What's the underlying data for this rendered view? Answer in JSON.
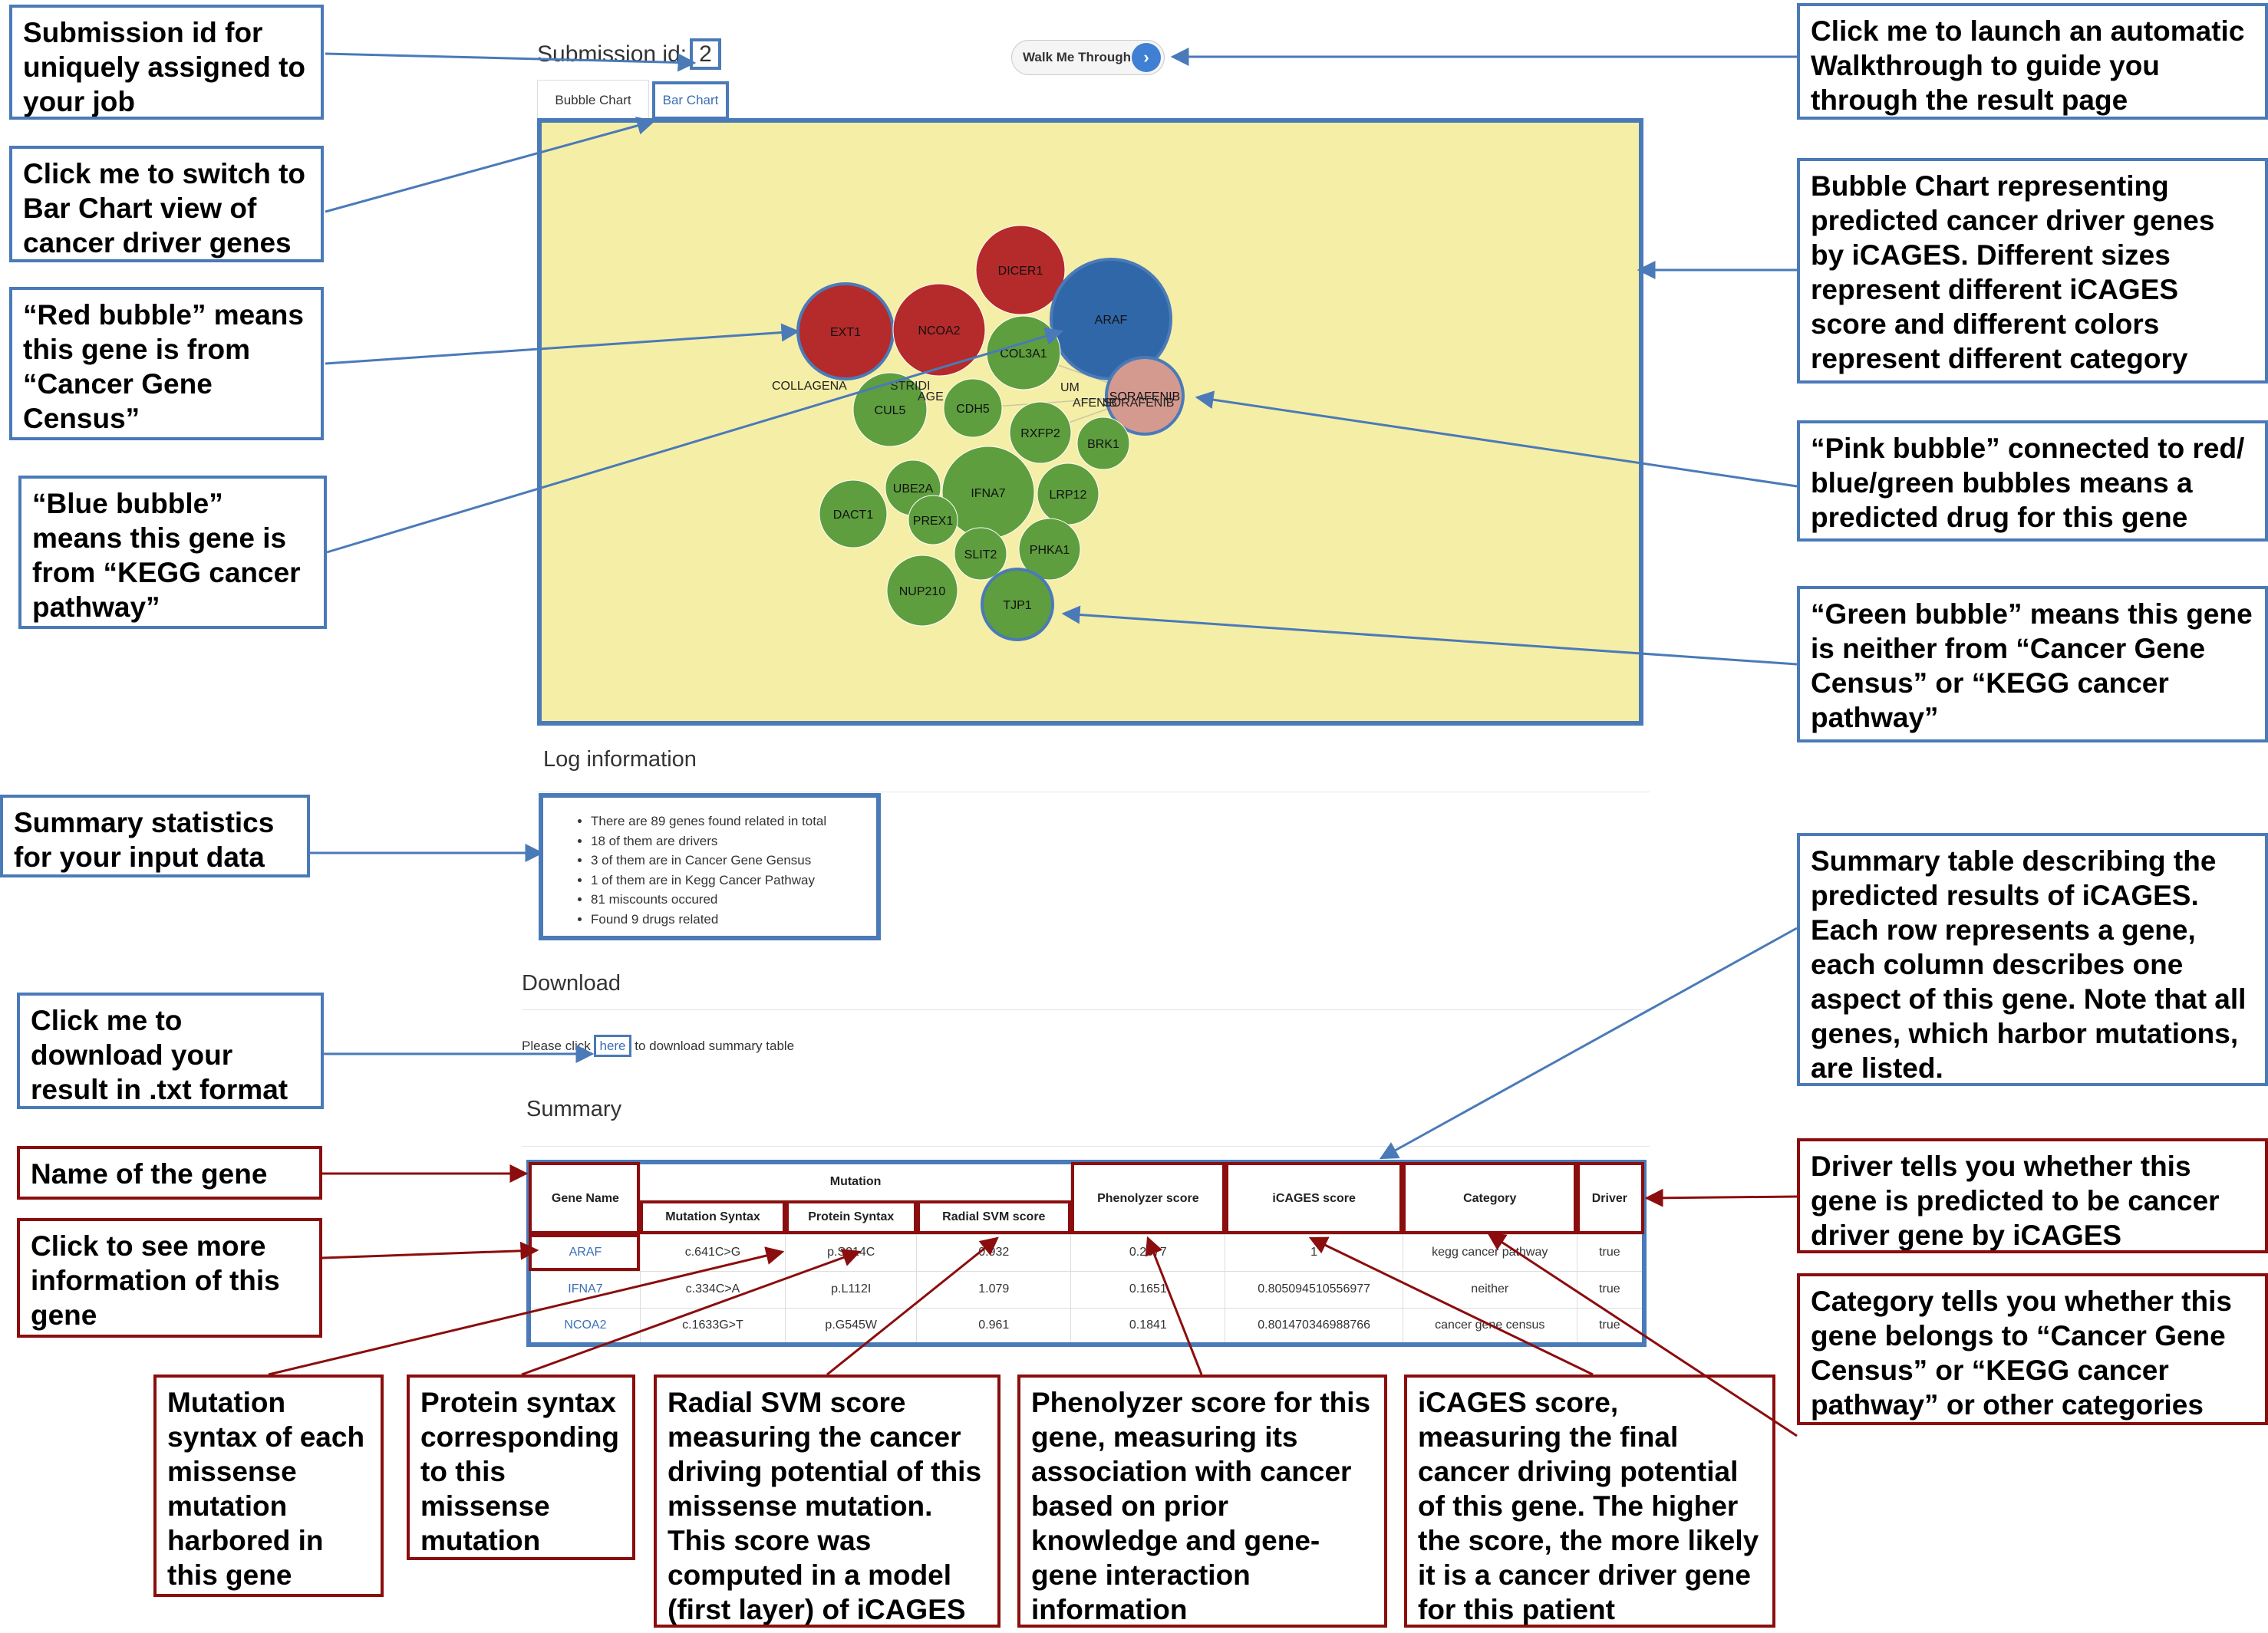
{
  "app": {
    "submission_label": "Submission id:",
    "submission_id": "2",
    "walk_button": "Walk Me Through",
    "tabs": [
      "Bubble Chart",
      "Bar Chart"
    ],
    "log_heading": "Log information",
    "log_items": [
      "There are 89 genes found related in total",
      "18 of them are drivers",
      "3 of them are in Cancer Gene Gensus",
      "1 of them are in Kegg Cancer Pathway",
      "81 miscounts occured",
      "Found 9 drugs related"
    ],
    "download_heading": "Download",
    "download_prefix": "Please click ",
    "download_link": "here",
    "download_suffix": " to download summary table",
    "summary_heading": "Summary"
  },
  "bubbles": [
    {
      "label": "DICER1",
      "color": "#b52a2a"
    },
    {
      "label": "EXT1",
      "color": "#b52a2a"
    },
    {
      "label": "NCOA2",
      "color": "#b52a2a"
    },
    {
      "label": "ARAF",
      "color": "#2f67a9"
    },
    {
      "label": "COL3A1",
      "color": "#5e9e3e"
    },
    {
      "label": "SORAFENIB",
      "color": "#d49a90"
    },
    {
      "label": "CUL5",
      "color": "#5e9e3e"
    },
    {
      "label": "CDH5",
      "color": "#5e9e3e"
    },
    {
      "label": "RXFP2",
      "color": "#5e9e3e"
    },
    {
      "label": "BRK1",
      "color": "#5e9e3e"
    },
    {
      "label": "UBE2A",
      "color": "#5e9e3e"
    },
    {
      "label": "IFNA7",
      "color": "#5e9e3e"
    },
    {
      "label": "LRP12",
      "color": "#5e9e3e"
    },
    {
      "label": "DACT1",
      "color": "#5e9e3e"
    },
    {
      "label": "PREX1",
      "color": "#5e9e3e"
    },
    {
      "label": "SLIT2",
      "color": "#5e9e3e"
    },
    {
      "label": "PHKA1",
      "color": "#5e9e3e"
    },
    {
      "label": "NUP210",
      "color": "#5e9e3e"
    },
    {
      "label": "TJP1",
      "color": "#5e9e3e"
    }
  ],
  "chart_overlay_labels": [
    "COLLAGENA",
    "STRIDI",
    "AGE",
    "UM",
    "AFENIB",
    "SORAFENIB"
  ],
  "table": {
    "header_gene": "Gene Name",
    "header_mutation": "Mutation",
    "sub_headers": [
      "Mutation Syntax",
      "Protein Syntax",
      "Radial SVM score"
    ],
    "header_phenolyzer": "Phenolyzer score",
    "header_icages": "iCAGES score",
    "header_category": "Category",
    "header_driver": "Driver",
    "rows": [
      [
        "ARAF",
        "c.641C>G",
        "p.S214C",
        "0.932",
        "0.2677",
        "1",
        "kegg cancer pathway",
        "true"
      ],
      [
        "IFNA7",
        "c.334C>A",
        "p.L112I",
        "1.079",
        "0.1651",
        "0.805094510556977",
        "neither",
        "true"
      ],
      [
        "NCOA2",
        "c.1633G>T",
        "p.G545W",
        "0.961",
        "0.1841",
        "0.801470346988766",
        "cancer gene census",
        "true"
      ]
    ]
  },
  "notes": {
    "submission": "Submission id for uniquely assigned to your job",
    "barchart": "Click me to switch to Bar Chart view of cancer driver genes",
    "red": "“Red bubble” means this gene is from “Cancer Gene Census”",
    "blue": "“Blue bubble” means this gene is from “KEGG cancer pathway”",
    "summary_stats": "Summary statistics for your input data",
    "download": "Click me to download your result in .txt format",
    "walkthrough": "Click me to launch an automatic Walkthrough to guide you through the result page",
    "bubble_chart": "Bubble Chart representing predicted cancer driver genes by iCAGES. Different sizes represent different iCAGES score and different colors represent different category",
    "pink": "“Pink bubble” connected to red/ blue/green bubbles means a predicted drug for this gene",
    "green": "“Green bubble” means this gene is neither from “Cancer Gene Census” or “KEGG cancer pathway”",
    "summary_table": "Summary table describing the predicted results of iCAGES. Each row represents a gene, each column describes one aspect of this gene. Note that all genes, which harbor mutations, are listed.",
    "gene_name": "Name of the gene",
    "click_gene": "Click to see more information of this gene",
    "driver": "Driver tells you whether this gene is predicted to be cancer driver gene by iCAGES",
    "category": "Category tells you whether this gene belongs to “Cancer Gene Census” or “KEGG cancer pathway” or other categories",
    "mutation_syntax": "Mutation syntax of each missense mutation harbored in this gene",
    "protein_syntax": "Protein syntax corresponding to this missense mutation",
    "radial_svm": "Radial SVM score measuring the cancer driving potential of this missense mutation. This score was computed in a model (first layer) of iCAGES",
    "phenolyzer": "Phenolyzer score for this gene, measuring its association with cancer based on prior knowledge and gene-gene interaction information",
    "icages_score": "iCAGES score, measuring the final cancer driving potential of this gene. The higher the score, the more likely it is a cancer driver gene for this patient"
  },
  "colors": {
    "annotation_blue": "#4a7ab8",
    "annotation_red": "#8b0d0d",
    "chart_bg": "#f5eea6"
  }
}
